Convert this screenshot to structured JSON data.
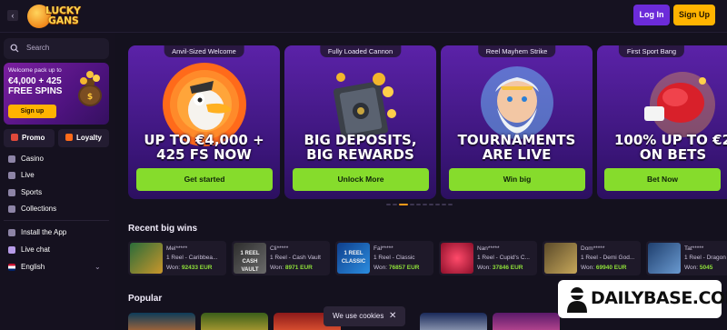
{
  "header": {
    "logo_text_line1": "LUCKY",
    "logo_text_line2": "GANS",
    "login_label": "Log In",
    "signup_label": "Sign Up"
  },
  "sidebar": {
    "search_placeholder": "Search",
    "promo": {
      "small_text": "Welcome pack up to",
      "big_text": "€4,000 + 425 FREE SPINS",
      "button_label": "Sign up"
    },
    "pills": [
      {
        "label": "Promo",
        "icon": "gift-icon"
      },
      {
        "label": "Loyalty",
        "icon": "flame-icon"
      }
    ],
    "nav": [
      {
        "label": "Casino",
        "icon": "casino-icon"
      },
      {
        "label": "Live",
        "icon": "live-icon"
      },
      {
        "label": "Sports",
        "icon": "sports-icon"
      },
      {
        "label": "Collections",
        "icon": "collections-icon"
      },
      {
        "label": "Install the App",
        "icon": "download-icon"
      },
      {
        "label": "Live chat",
        "icon": "chat-icon"
      },
      {
        "label": "English",
        "icon": "flag-icon"
      }
    ]
  },
  "banners": [
    {
      "tag": "Anvil-Sized Welcome",
      "title_line1": "UP TO €4,000 +",
      "title_line2": "425 FS NOW",
      "button": "Get started"
    },
    {
      "tag": "Fully Loaded Cannon",
      "title_line1": "BIG DEPOSITS,",
      "title_line2": "BIG REWARDS",
      "button": "Unlock More"
    },
    {
      "tag": "Reel Mayhem Strike",
      "title_line1": "TOURNAMENTS",
      "title_line2": "ARE LIVE",
      "button": "Win big"
    },
    {
      "tag": "First Sport Bang",
      "title_line1": "100% UP TO €2",
      "title_line2": "ON BETS",
      "button": "Bet Now"
    }
  ],
  "recent_wins": {
    "title": "Recent big wins",
    "items": [
      {
        "name": "Mel*****",
        "game": "1 Reel - Caribbea...",
        "won_label": "Won:",
        "amount": "92433 EUR",
        "thumb_text": ""
      },
      {
        "name": "Cli*****",
        "game": "1 Reel - Cash Vault",
        "won_label": "Won:",
        "amount": "8971 EUR",
        "thumb_text": "1 REEL CASH VAULT"
      },
      {
        "name": "Fal*****",
        "game": "1 Reel - Classic",
        "won_label": "Won:",
        "amount": "76857 EUR",
        "thumb_text": "1 REEL CLASSIC"
      },
      {
        "name": "Nan*****",
        "game": "1 Reel - Cupid's C...",
        "won_label": "Won:",
        "amount": "37846 EUR",
        "thumb_text": ""
      },
      {
        "name": "Dom*****",
        "game": "1 Reel - Demi God...",
        "won_label": "Won:",
        "amount": "69940 EUR",
        "thumb_text": ""
      },
      {
        "name": "Tat*****",
        "game": "1 Reel - Dragon G...",
        "won_label": "Won:",
        "amount": "5045",
        "thumb_text": ""
      }
    ]
  },
  "popular": {
    "title": "Popular"
  },
  "cookie": {
    "text": "We use cookies"
  },
  "watermark": {
    "text": "DAILYBASE.COM"
  },
  "colors": {
    "accent_purple": "#6c2bd9",
    "accent_yellow": "#ffb300",
    "button_green": "#86dc2c",
    "win_green": "#8ee03a"
  }
}
